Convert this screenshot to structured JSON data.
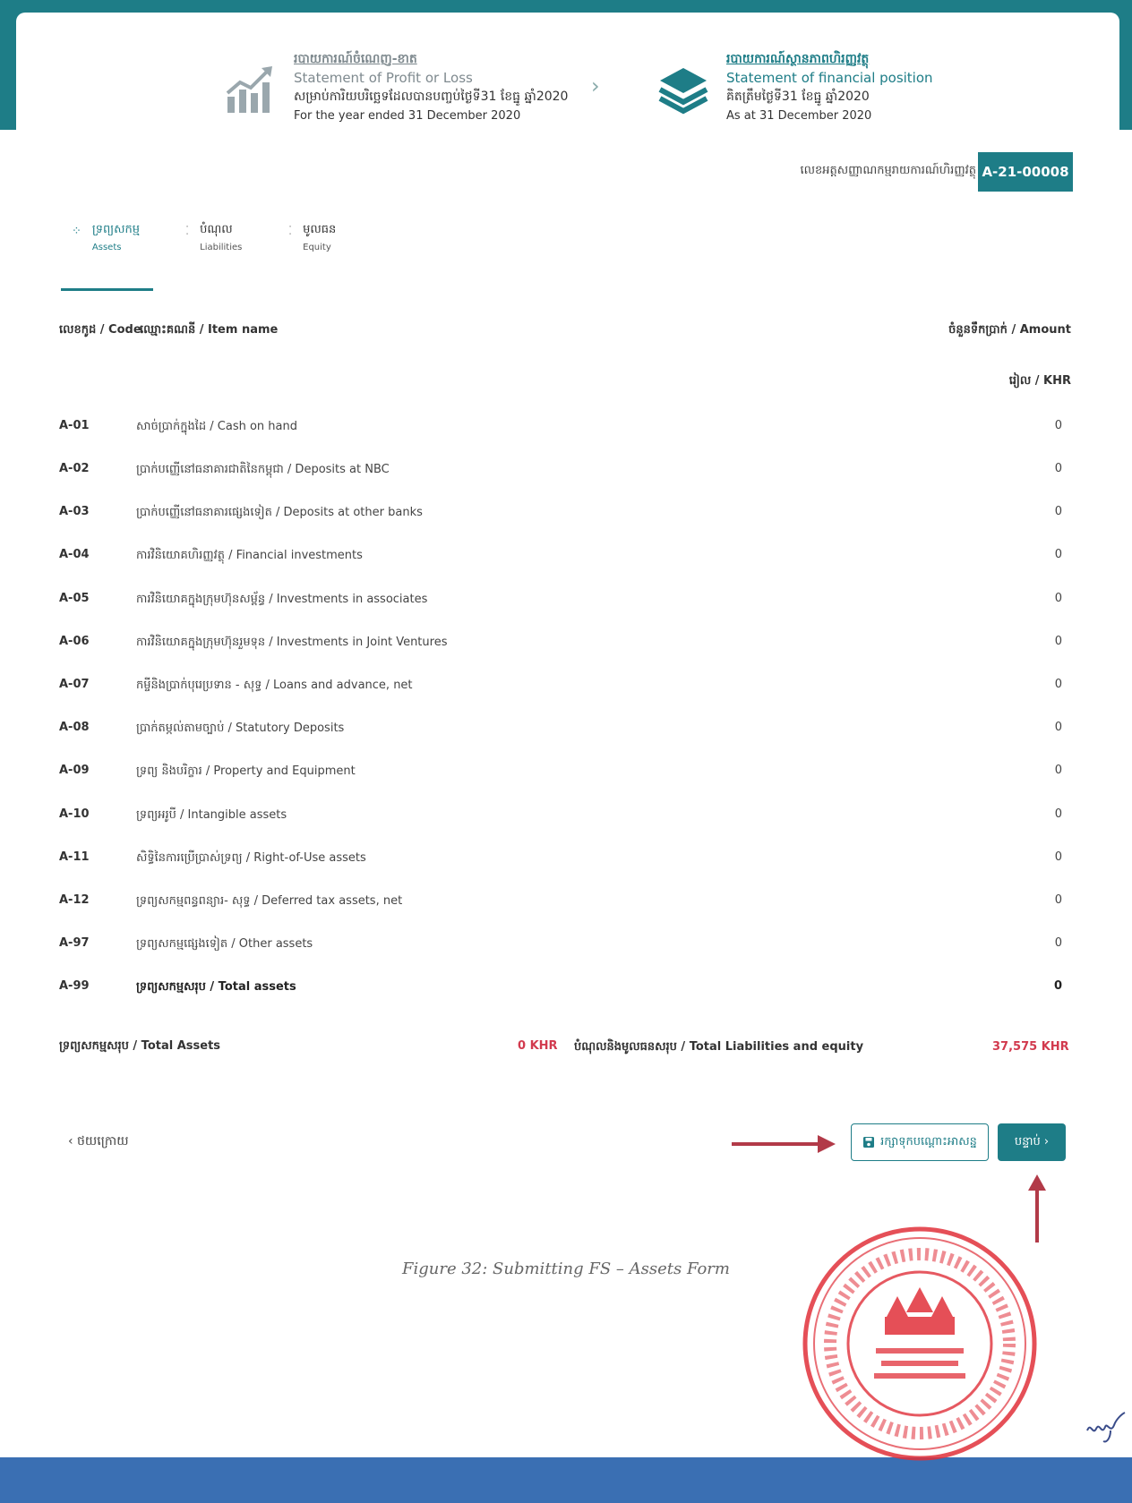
{
  "steps": [
    {
      "kh_title": "របាយការណ៍ចំណេញ-ខាត",
      "en_title": "Statement of Profit or Loss",
      "kh_sub": "សម្រាប់ការិយបរិច្ឆេទដែលបានបញ្ចប់ថ្ងៃទី31 ខែធ្នូ ឆ្នាំ2020",
      "en_sub": "For the year ended 31 December 2020"
    },
    {
      "kh_title": "របាយការណ៍ស្ថានភាពហិរញ្ញវត្ថុ",
      "en_title": "Statement of financial position",
      "kh_sub": "គិតត្រឹមថ្ងៃទី31 ខែធ្នូ ឆ្នាំ2020",
      "en_sub": "As at 31 December 2020"
    }
  ],
  "registration": {
    "label": "លេខអត្តសញ្ញាណកម្មរាយការណ៍ហិរញ្ញវត្ថុ",
    "value": "A-21-00008"
  },
  "tabs": [
    {
      "kh": "ទ្រព្យសកម្ម",
      "en": "Assets"
    },
    {
      "kh": "បំណុល",
      "en": "Liabilities"
    },
    {
      "kh": "មូលធន",
      "en": "Equity"
    }
  ],
  "table": {
    "header_code": "លេខកូដ / Code",
    "header_name": "ឈ្មោះគណនី / Item name",
    "header_amount": "ចំនួនទឹកប្រាក់ / Amount",
    "unit": "រៀល / KHR",
    "rows": [
      {
        "code": "A-01",
        "name": "សាច់ប្រាក់ក្នុងដៃ / Cash on hand",
        "amount": "0"
      },
      {
        "code": "A-02",
        "name": "ប្រាក់បញ្ញើនៅធនាគារជាតិនៃកម្ពុជា / Deposits at NBC",
        "amount": "0"
      },
      {
        "code": "A-03",
        "name": "ប្រាក់បញ្ញើនៅធនាគារផ្សេងទៀត / Deposits at other banks",
        "amount": "0"
      },
      {
        "code": "A-04",
        "name": "ការវិនិយោគហិរញ្ញវត្ថុ / Financial investments",
        "amount": "0"
      },
      {
        "code": "A-05",
        "name": "ការវិនិយោគក្នុងក្រុមហ៊ុនសម្ព័ន្ធ / Investments in associates",
        "amount": "0"
      },
      {
        "code": "A-06",
        "name": "ការវិនិយោគក្នុងក្រុមហ៊ុនរួមទុន / Investments in Joint Ventures",
        "amount": "0"
      },
      {
        "code": "A-07",
        "name": "កម្ចីនិងប្រាក់បុរេប្រទាន - សុទ្ធ / Loans and advance, net",
        "amount": "0"
      },
      {
        "code": "A-08",
        "name": "ប្រាក់តម្កល់តាមច្បាប់ / Statutory Deposits",
        "amount": "0"
      },
      {
        "code": "A-09",
        "name": "ទ្រព្យ និងបរិក្ខារ / Property and Equipment",
        "amount": "0"
      },
      {
        "code": "A-10",
        "name": "ទ្រព្យអរូបី / Intangible assets",
        "amount": "0"
      },
      {
        "code": "A-11",
        "name": "សិទ្ធិនៃការប្រើប្រាស់ទ្រព្យ / Right-of-Use assets",
        "amount": "0"
      },
      {
        "code": "A-12",
        "name": "ទ្រព្យសកម្មពន្ធពន្យារ- សុទ្ធ / Deferred tax assets, net",
        "amount": "0"
      },
      {
        "code": "A-97",
        "name": "ទ្រព្យសកម្មផ្សេងទៀត / Other assets",
        "amount": "0"
      },
      {
        "code": "A-99",
        "name": "ទ្រព្យសកម្មសរុប / Total assets",
        "amount": "0"
      }
    ]
  },
  "summary": {
    "assets_label": "ទ្រព្យសកម្មសរុប / Total Assets",
    "assets_value": "0 KHR",
    "liab_label": "បំណុលនិងមូលធនសរុប / Total Liabilities and equity",
    "liab_value": "37,575 KHR"
  },
  "actions": {
    "back": "‹ ថយក្រោយ",
    "draft": "រក្សាទុកបណ្តោះអាសន្ន",
    "next": "បន្ទាប់ ›"
  },
  "caption": "Figure 32: Submitting FS – Assets Form",
  "colors": {
    "teal": "#1e7d87",
    "red": "#d23a4e",
    "bottom_band": "#3a6fb3",
    "stamp": "#e0303a"
  },
  "icons": [
    "growth-chart-icon",
    "layers-icon",
    "chevron-right-icon",
    "save-icon",
    "arrow-right-icon",
    "arrow-up-icon",
    "official-stamp",
    "signature"
  ]
}
